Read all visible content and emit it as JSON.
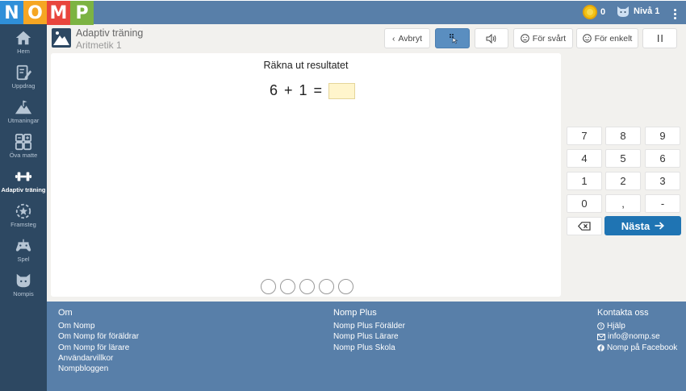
{
  "brand": {
    "letters": [
      {
        "char": "N",
        "color": "#2f8fd8"
      },
      {
        "char": "O",
        "color": "#f5a623"
      },
      {
        "char": "M",
        "color": "#e8453c"
      },
      {
        "char": "P",
        "color": "#7cb342"
      }
    ]
  },
  "topbar": {
    "coin_count": "0",
    "level": "Nivå 1"
  },
  "sidebar": {
    "items": [
      {
        "label": "Hem",
        "icon": "home-icon"
      },
      {
        "label": "Uppdrag",
        "icon": "pencil-paper-icon"
      },
      {
        "label": "Utmaningar",
        "icon": "mountain-flag-icon"
      },
      {
        "label": "Öva matte",
        "icon": "calculator-icon"
      },
      {
        "label": "Adaptiv träning",
        "icon": "dumbbell-icon",
        "active": true
      },
      {
        "label": "Framsteg",
        "icon": "star-circle-icon"
      },
      {
        "label": "Spel",
        "icon": "gamepad-icon"
      },
      {
        "label": "Nompis",
        "icon": "cat-face-icon"
      }
    ]
  },
  "header": {
    "title": "Adaptiv träning",
    "subtitle": "Aritmetik 1"
  },
  "toolbar": {
    "cancel_label": "Avbryt",
    "harder_label": "För svårt",
    "easier_label": "För enkelt"
  },
  "exercise": {
    "instruction": "Räkna ut resultatet",
    "operand_a": "6",
    "operator": "+",
    "operand_b": "1",
    "equals": "=",
    "answer": "",
    "progress_total": 5,
    "progress_done": 0
  },
  "keypad": {
    "keys": [
      "7",
      "8",
      "9",
      "4",
      "5",
      "6",
      "1",
      "2",
      "3",
      "0",
      ",",
      "-"
    ],
    "next_label": "Nästa"
  },
  "footer": {
    "about": {
      "heading": "Om",
      "links": [
        "Om Nomp",
        "Om Nomp för föräldrar",
        "Om Nomp för lärare",
        "Användarvillkor",
        "Nompbloggen"
      ]
    },
    "plus": {
      "heading": "Nomp Plus",
      "links": [
        "Nomp Plus Förälder",
        "Nomp Plus Lärare",
        "Nomp Plus Skola"
      ]
    },
    "contact": {
      "heading": "Kontakta oss",
      "links": [
        {
          "label": "Hjälp",
          "icon": "question-circle-icon"
        },
        {
          "label": "info@nomp.se",
          "icon": "envelope-icon"
        },
        {
          "label": "Nomp på Facebook",
          "icon": "facebook-icon"
        }
      ]
    }
  },
  "colors": {
    "topbar": "#587fa9",
    "sidebar": "#2d4862",
    "accent": "#1f74b3",
    "answer_box": "#fff5cc"
  }
}
